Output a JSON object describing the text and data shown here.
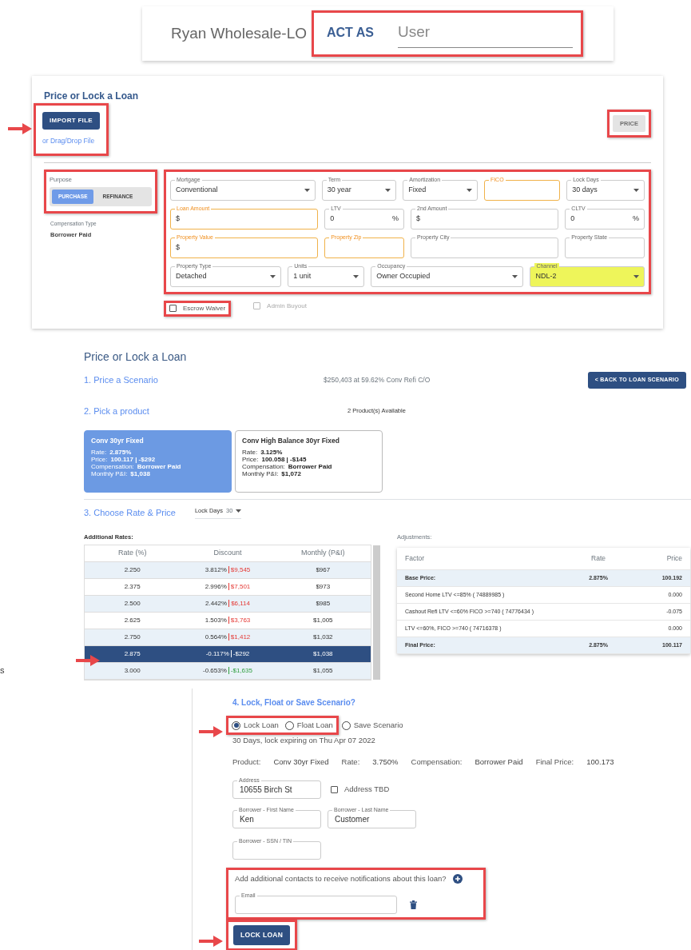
{
  "header": {
    "user_name": "Ryan Wholesale-LO",
    "act_as_label": "ACT AS",
    "act_as_placeholder": "User",
    "highlighted": true
  },
  "loan_form": {
    "title": "Price or Lock a Loan",
    "import_button": {
      "label": "IMPORT FILE",
      "highlighted": true,
      "arrow": true
    },
    "drag_drop_link": "or Drag/Drop File",
    "price_button": {
      "label": "PRICE",
      "disabled": true,
      "highlighted": true
    },
    "purpose": {
      "label": "Purpose",
      "highlighted": true,
      "options": [
        {
          "label": "PURCHASE",
          "selected": true
        },
        {
          "label": "REFINANCE",
          "selected": false
        }
      ]
    },
    "compensation": {
      "label": "Compensation Type",
      "value": "Borrower Paid"
    },
    "fields_highlighted": true,
    "field_rows": [
      [
        {
          "label": "Mortgage",
          "kind": "select",
          "value": "Conventional",
          "required": false
        },
        {
          "label": "Term",
          "kind": "select",
          "value": "30 year",
          "required": false
        },
        {
          "label": "Amortization",
          "kind": "select",
          "value": "Fixed",
          "required": false
        },
        {
          "label": "FICO",
          "kind": "input",
          "required": true
        },
        {
          "label": "Lock Days",
          "kind": "select",
          "value": "30 days",
          "required": false
        }
      ],
      [
        {
          "label": "Loan Amount",
          "kind": "input",
          "prefix": "$",
          "required": true
        },
        {
          "label": "LTV",
          "kind": "input",
          "value": "0",
          "suffix": "%",
          "required": false
        },
        {
          "label": "2nd Amount",
          "kind": "input",
          "prefix": "$",
          "required": false
        },
        {
          "label": "CLTV",
          "kind": "input",
          "value": "0",
          "suffix": "%",
          "required": false
        }
      ],
      [
        {
          "label": "Property Value",
          "kind": "input",
          "prefix": "$",
          "required": true
        },
        {
          "label": "Property Zip",
          "kind": "input",
          "required": true
        },
        {
          "label": "Property City",
          "kind": "input",
          "required": false
        },
        {
          "label": "Property State",
          "kind": "input",
          "required": false
        }
      ],
      [
        {
          "label": "Property Type",
          "kind": "select",
          "value": "Detached",
          "required": false
        },
        {
          "label": "Units",
          "kind": "select",
          "value": "1 unit",
          "required": false
        },
        {
          "label": "Occupancy",
          "kind": "select",
          "value": "Owner Occupied",
          "required": false
        },
        {
          "label": "Channel",
          "kind": "select",
          "value": "NDL-2",
          "required": false,
          "highlighted": true
        }
      ]
    ],
    "checkboxes": [
      {
        "label": "Escrow Waiver",
        "checked": false,
        "disabled": false,
        "highlighted": true
      },
      {
        "label": "Admin Buyout",
        "checked": false,
        "disabled": true,
        "highlighted": false
      }
    ]
  },
  "pricing": {
    "title": "Price or Lock a Loan",
    "step1": {
      "title": "1. Price a Scenario",
      "summary": "$250,403 at 59.62% Conv Refi C/O",
      "button": "< BACK TO LOAN SCENARIO"
    },
    "step2": {
      "title": "2. Pick a product",
      "count": "2 Product(s) Available",
      "products": [
        {
          "name": "Conv 30yr Fixed",
          "selected": true,
          "lines": [
            {
              "label": "Rate:",
              "value": "2.875%"
            },
            {
              "label": "Price:",
              "value": "100.117 | -$292"
            },
            {
              "label": "Compensation:",
              "value": "Borrower Paid"
            },
            {
              "label": "Monthly P&I:",
              "value": "$1,038"
            }
          ]
        },
        {
          "name": "Conv High Balance 30yr Fixed",
          "selected": false,
          "lines": [
            {
              "label": "Rate:",
              "value": "3.125%"
            },
            {
              "label": "Price:",
              "value": "100.058 | -$145"
            },
            {
              "label": "Compensation:",
              "value": "Borrower Paid"
            },
            {
              "label": "Monthly P&I:",
              "value": "$1,072"
            }
          ]
        }
      ]
    },
    "step3": {
      "title": "3. Choose Rate & Price",
      "lock_days_label": "Lock Days",
      "lock_days_value": "30",
      "rates_title": "Additional Rates:",
      "rate_columns": [
        "Rate (%)",
        "Discount",
        "Monthly (P&I)"
      ],
      "rates": [
        {
          "rate": "2.250",
          "discount": "3.812%",
          "amount": "$9,545",
          "kind": "charge",
          "monthly": "$967",
          "selected": false
        },
        {
          "rate": "2.375",
          "discount": "2.996%",
          "amount": "$7,501",
          "kind": "charge",
          "monthly": "$973",
          "selected": false
        },
        {
          "rate": "2.500",
          "discount": "2.442%",
          "amount": "$6,114",
          "kind": "charge",
          "monthly": "$985",
          "selected": false
        },
        {
          "rate": "2.625",
          "discount": "1.503%",
          "amount": "$3,763",
          "kind": "charge",
          "monthly": "$1,005",
          "selected": false
        },
        {
          "rate": "2.750",
          "discount": "0.564%",
          "amount": "$1,412",
          "kind": "charge",
          "monthly": "$1,032",
          "selected": false
        },
        {
          "rate": "2.875",
          "discount": "-0.117%",
          "amount": "-$292",
          "kind": "credit",
          "monthly": "$1,038",
          "selected": true,
          "arrow": true
        },
        {
          "rate": "3.000",
          "discount": "-0.653%",
          "amount": "-$1,635",
          "kind": "credit",
          "monthly": "$1,055",
          "selected": false
        }
      ],
      "adjustments_title": "Adjustments:",
      "adjustment_columns": [
        "Factor",
        "Rate",
        "Price"
      ],
      "adjustments": [
        {
          "factor": "Base Price:",
          "rate": "2.875%",
          "price": "100.192",
          "kind": "total"
        },
        {
          "factor": "Second Home LTV <=85% ( 74889985 )",
          "price": "0.000",
          "kind": "line"
        },
        {
          "factor": "Cashout Refi LTV <=60% FICO >=740 ( 74776434 )",
          "price": "-0.075",
          "kind": "line"
        },
        {
          "factor": "LTV <=60%, FICO >=740 ( 74716378 )",
          "price": "0.000",
          "kind": "line"
        },
        {
          "factor": "Final Price:",
          "rate": "2.875%",
          "price": "100.117",
          "kind": "total"
        }
      ]
    }
  },
  "edge_text": "s",
  "lock": {
    "title": "4. Lock, Float or Save Scenario?",
    "options": [
      {
        "label": "Lock Loan",
        "selected": true,
        "highlighted": true,
        "arrow": true
      },
      {
        "label": "Float Loan",
        "selected": false,
        "highlighted": true
      },
      {
        "label": "Save Scenario",
        "selected": false,
        "highlighted": false
      }
    ],
    "expiry": "30 Days, lock expiring on Thu Apr 07 2022",
    "summary": [
      {
        "label": "Product:",
        "value": "Conv 30yr Fixed"
      },
      {
        "label": "Rate:",
        "value": "3.750%"
      },
      {
        "label": "Compensation:",
        "value": "Borrower Paid"
      },
      {
        "label": "Final Price:",
        "value": "100.173"
      }
    ],
    "address": {
      "label": "Address",
      "value": "10655 Birch St"
    },
    "address_tbd": {
      "label": "Address TBD",
      "checked": false
    },
    "first_name": {
      "label": "Borrower - First Name",
      "value": "Ken"
    },
    "last_name": {
      "label": "Borrower - Last Name",
      "value": "Customer"
    },
    "ssn": {
      "label": "Borrower - SSN / TIN"
    },
    "contacts": {
      "prompt": "Add additional contacts to receive notifications about this loan?",
      "email_label": "Email",
      "highlighted": true
    },
    "lock_button": {
      "label": "LOCK LOAN",
      "highlighted": true,
      "arrow": true
    }
  }
}
